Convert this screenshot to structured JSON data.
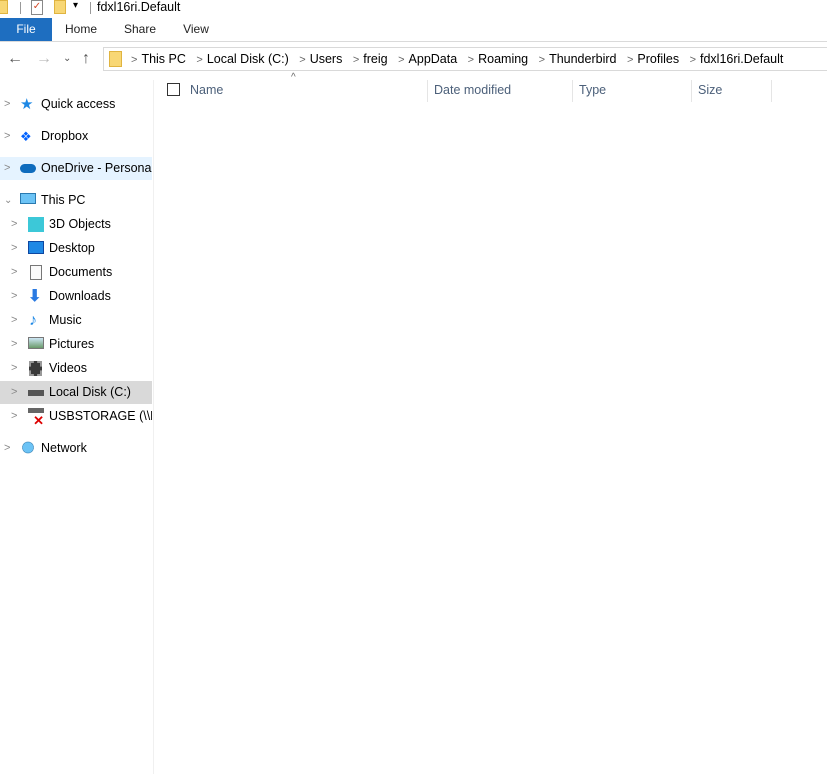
{
  "window": {
    "title": "fdxl16ri.Default"
  },
  "ribbon": {
    "tabs": [
      "File",
      "Home",
      "Share",
      "View"
    ]
  },
  "address": {
    "crumbs": [
      "This PC",
      "Local Disk (C:)",
      "Users",
      "freig",
      "AppData",
      "Roaming",
      "Thunderbird",
      "Profiles",
      "fdxl16ri.Default"
    ]
  },
  "nav": {
    "quick_access": "Quick access",
    "dropbox": "Dropbox",
    "onedrive": "OneDrive - Personal",
    "this_pc": "This PC",
    "children": [
      "3D Objects",
      "Desktop",
      "Documents",
      "Downloads",
      "Music",
      "Pictures",
      "Videos",
      "Local Disk (C:)",
      "USBSTORAGE (\\\\EPS"
    ],
    "network": "Network"
  },
  "columns": {
    "name": "Name",
    "date": "Date modified",
    "type": "Type",
    "size": "Size"
  }
}
